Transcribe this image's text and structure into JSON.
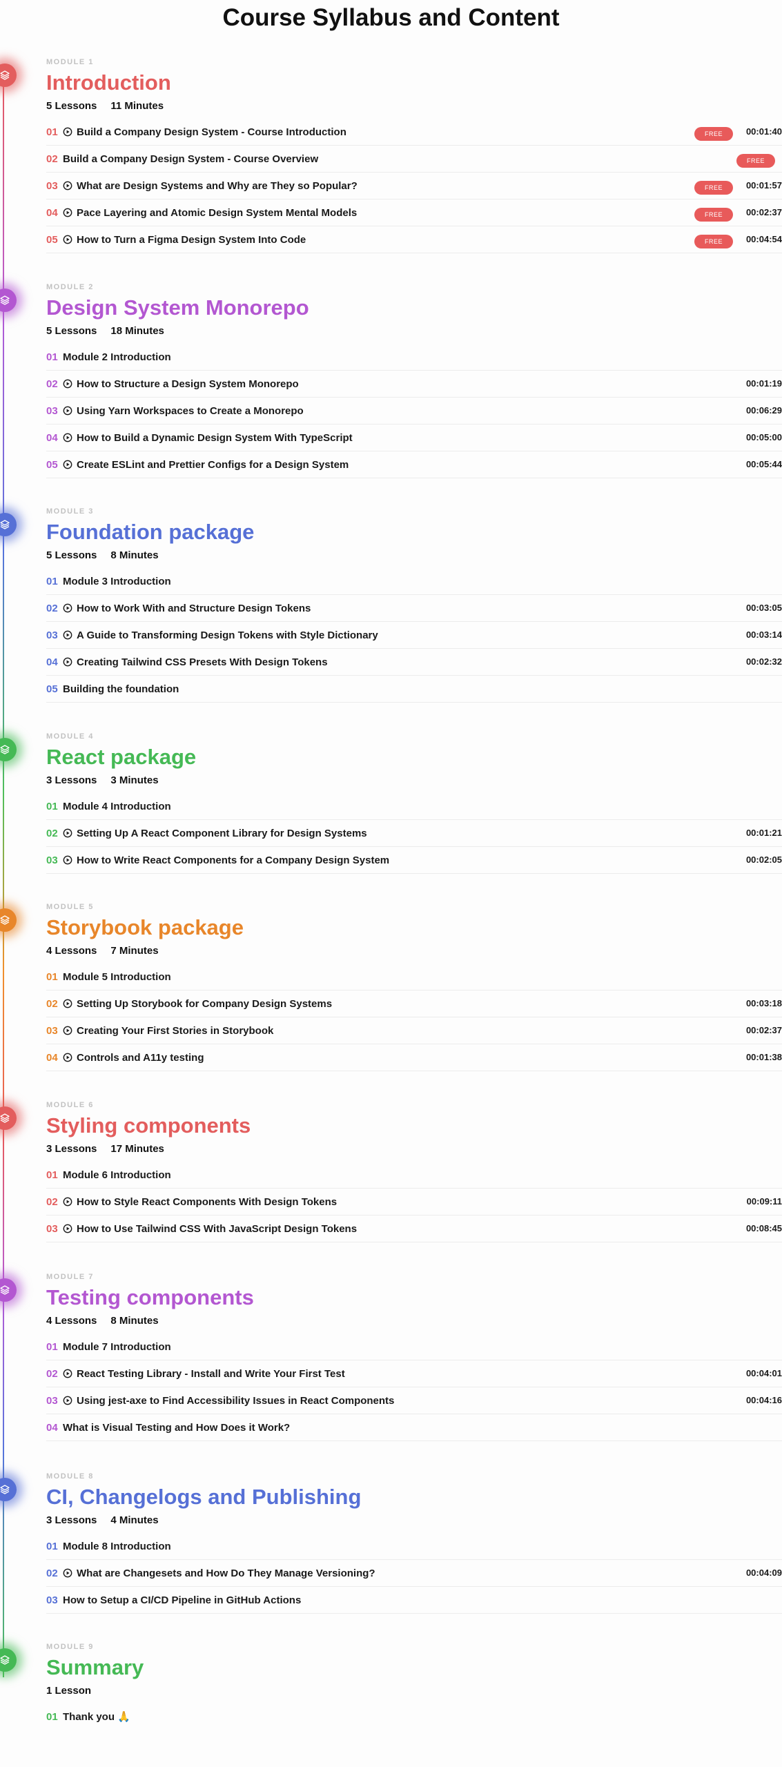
{
  "page": {
    "title": "Course Syllabus and Content"
  },
  "modules": [
    {
      "label": "MODULE 1",
      "title": "Introduction",
      "color": "#e35d5d",
      "lessons_count": "5 Lessons",
      "duration": "11 Minutes",
      "lessons": [
        {
          "num": "01",
          "video": true,
          "title": "Build a Company Design System - Course Introduction",
          "free": "FREE",
          "time": "00:01:40"
        },
        {
          "num": "02",
          "video": false,
          "title": "Build a Company Design System - Course Overview",
          "free": "FREE",
          "time": ""
        },
        {
          "num": "03",
          "video": true,
          "title": "What are Design Systems and Why are They so Popular?",
          "free": "FREE",
          "time": "00:01:57"
        },
        {
          "num": "04",
          "video": true,
          "title": "Pace Layering and Atomic Design System Mental Models",
          "free": "FREE",
          "time": "00:02:37"
        },
        {
          "num": "05",
          "video": true,
          "title": "How to Turn a Figma Design System Into Code",
          "free": "FREE",
          "time": "00:04:54"
        }
      ]
    },
    {
      "label": "MODULE 2",
      "title": "Design System Monorepo",
      "color": "#b357d1",
      "lessons_count": "5 Lessons",
      "duration": "18 Minutes",
      "lessons": [
        {
          "num": "01",
          "video": false,
          "title": "Module 2 Introduction",
          "free": "",
          "time": ""
        },
        {
          "num": "02",
          "video": true,
          "title": "How to Structure a Design System Monorepo",
          "free": "",
          "time": "00:01:19"
        },
        {
          "num": "03",
          "video": true,
          "title": "Using Yarn Workspaces to Create a Monorepo",
          "free": "",
          "time": "00:06:29"
        },
        {
          "num": "04",
          "video": true,
          "title": "How to Build a Dynamic Design System With TypeScript",
          "free": "",
          "time": "00:05:00"
        },
        {
          "num": "05",
          "video": true,
          "title": "Create ESLint and Prettier Configs for a Design System",
          "free": "",
          "time": "00:05:44"
        }
      ]
    },
    {
      "label": "MODULE 3",
      "title": "Foundation package",
      "color": "#5670d6",
      "lessons_count": "5 Lessons",
      "duration": "8 Minutes",
      "lessons": [
        {
          "num": "01",
          "video": false,
          "title": "Module 3 Introduction",
          "free": "",
          "time": ""
        },
        {
          "num": "02",
          "video": true,
          "title": "How to Work With and Structure Design Tokens",
          "free": "",
          "time": "00:03:05"
        },
        {
          "num": "03",
          "video": true,
          "title": "A Guide to Transforming Design Tokens with Style Dictionary",
          "free": "",
          "time": "00:03:14"
        },
        {
          "num": "04",
          "video": true,
          "title": "Creating Tailwind CSS Presets With Design Tokens",
          "free": "",
          "time": "00:02:32"
        },
        {
          "num": "05",
          "video": false,
          "title": "Building the foundation",
          "free": "",
          "time": ""
        }
      ]
    },
    {
      "label": "MODULE 4",
      "title": "React package",
      "color": "#45b955",
      "lessons_count": "3 Lessons",
      "duration": "3 Minutes",
      "lessons": [
        {
          "num": "01",
          "video": false,
          "title": "Module 4 Introduction",
          "free": "",
          "time": ""
        },
        {
          "num": "02",
          "video": true,
          "title": "Setting Up A React Component Library for Design Systems",
          "free": "",
          "time": "00:01:21"
        },
        {
          "num": "03",
          "video": true,
          "title": "How to Write React Components for a Company Design System",
          "free": "",
          "time": "00:02:05"
        }
      ]
    },
    {
      "label": "MODULE 5",
      "title": "Storybook package",
      "color": "#e8862a",
      "lessons_count": "4 Lessons",
      "duration": "7 Minutes",
      "lessons": [
        {
          "num": "01",
          "video": false,
          "title": "Module 5 Introduction",
          "free": "",
          "time": ""
        },
        {
          "num": "02",
          "video": true,
          "title": "Setting Up Storybook for Company Design Systems",
          "free": "",
          "time": "00:03:18"
        },
        {
          "num": "03",
          "video": true,
          "title": "Creating Your First Stories in Storybook",
          "free": "",
          "time": "00:02:37"
        },
        {
          "num": "04",
          "video": true,
          "title": "Controls and A11y testing",
          "free": "",
          "time": "00:01:38"
        }
      ]
    },
    {
      "label": "MODULE 6",
      "title": "Styling components",
      "color": "#e35d5d",
      "lessons_count": "3 Lessons",
      "duration": "17 Minutes",
      "lessons": [
        {
          "num": "01",
          "video": false,
          "title": "Module 6 Introduction",
          "free": "",
          "time": ""
        },
        {
          "num": "02",
          "video": true,
          "title": "How to Style React Components With Design Tokens",
          "free": "",
          "time": "00:09:11"
        },
        {
          "num": "03",
          "video": true,
          "title": "How to Use Tailwind CSS With JavaScript Design Tokens",
          "free": "",
          "time": "00:08:45"
        }
      ]
    },
    {
      "label": "MODULE 7",
      "title": "Testing components",
      "color": "#b357d1",
      "lessons_count": "4 Lessons",
      "duration": "8 Minutes",
      "lessons": [
        {
          "num": "01",
          "video": false,
          "title": "Module 7 Introduction",
          "free": "",
          "time": ""
        },
        {
          "num": "02",
          "video": true,
          "title": "React Testing Library - Install and Write Your First Test",
          "free": "",
          "time": "00:04:01"
        },
        {
          "num": "03",
          "video": true,
          "title": "Using jest-axe to Find Accessibility Issues in React Components",
          "free": "",
          "time": "00:04:16"
        },
        {
          "num": "04",
          "video": false,
          "title": "What is Visual Testing and How Does it Work?",
          "free": "",
          "time": ""
        }
      ]
    },
    {
      "label": "MODULE 8",
      "title": "CI, Changelogs and Publishing",
      "color": "#5670d6",
      "lessons_count": "3 Lessons",
      "duration": "4 Minutes",
      "lessons": [
        {
          "num": "01",
          "video": false,
          "title": "Module 8 Introduction",
          "free": "",
          "time": ""
        },
        {
          "num": "02",
          "video": true,
          "title": "What are Changesets and How Do They Manage Versioning?",
          "free": "",
          "time": "00:04:09"
        },
        {
          "num": "03",
          "video": false,
          "title": "How to Setup a CI/CD Pipeline in GitHub Actions",
          "free": "",
          "time": ""
        }
      ]
    },
    {
      "label": "MODULE 9",
      "title": "Summary",
      "color": "#45b955",
      "lessons_count": "1 Lesson",
      "duration": "",
      "lessons": [
        {
          "num": "01",
          "video": false,
          "title": "Thank you 🙏",
          "free": "",
          "time": ""
        }
      ]
    }
  ]
}
